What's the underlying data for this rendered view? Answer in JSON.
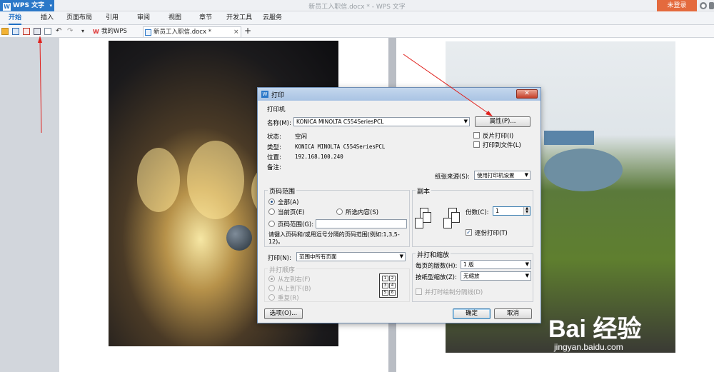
{
  "app": {
    "name": "WPS 文字",
    "doc_title": "新员工入职信.docx * - WPS 文字",
    "login_label": "未登录"
  },
  "menu": [
    "开始",
    "插入",
    "页面布局",
    "引用",
    "审阅",
    "视图",
    "章节",
    "开发工具",
    "云服务"
  ],
  "tabs": {
    "home_label": "我的WPS",
    "doc_label": "新员工入职信.docx *",
    "close_glyph": "×",
    "new_tab_glyph": "+"
  },
  "watermark": {
    "brand": "Bai 经验",
    "url": "jingyan.baidu.com"
  },
  "dialog": {
    "title": "打印",
    "close_glyph": "✕",
    "printer": {
      "section": "打印机",
      "name_label": "名称(M):",
      "name_value": "KONICA MINOLTA C554SeriesPCL",
      "properties_button": "属性(P)...",
      "status_label": "状态:",
      "status_value": "空闲",
      "type_label": "类型:",
      "type_value": "KONICA MINOLTA C554SeriesPCL",
      "location_label": "位置:",
      "location_value": "192.168.100.240",
      "comment_label": "备注:",
      "reverse_print": "反片打印(I)",
      "print_to_file": "打印到文件(L)",
      "paper_source_label": "纸张来源(S):",
      "paper_source_value": "使用打印机设置"
    },
    "page_range": {
      "section": "页码范围",
      "all": "全部(A)",
      "current": "当前页(E)",
      "selection": "所选内容(S)",
      "pages": "页码范围(G):",
      "hint": "请键入页码和/或用逗号分隔的页码范围(例如:1,3,5-12)。"
    },
    "copies": {
      "section": "副本",
      "count_label": "份数(C):",
      "count_value": "1",
      "collate": "逐份打印(T)"
    },
    "print_what_label": "打印(N):",
    "print_what_value": "范围中所有页面",
    "order": {
      "section": "并打顺序",
      "left_to_right": "从左到右(F)",
      "top_to_bottom": "从上到下(B)",
      "repeat": "重复(R)"
    },
    "zoom": {
      "section": "并打和缩放",
      "per_page_label": "每页的版数(H):",
      "per_page_value": "1 版",
      "scale_label": "按纸型缩放(Z):",
      "scale_value": "无缩放",
      "draw_lines": "并打时绘制分隔线(D)"
    },
    "options_button": "选项(O)...",
    "ok_button": "确定",
    "cancel_button": "取消"
  },
  "colors": {
    "accent": "#2b78c8",
    "login": "#e46a3d",
    "annotation": "#e0201c"
  }
}
